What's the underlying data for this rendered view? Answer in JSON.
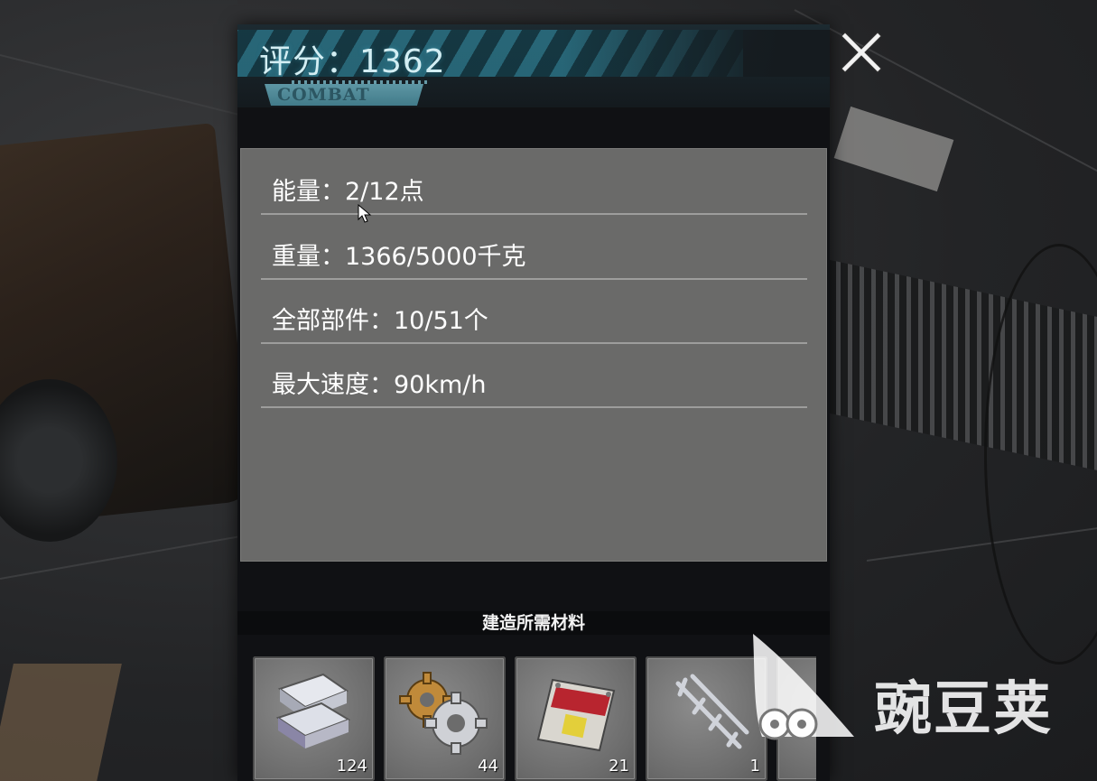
{
  "panel": {
    "score_text": "评分：1362",
    "combat_tag": "COMBAT",
    "stats": [
      {
        "text": "能量：2/12点"
      },
      {
        "text": "重量：1366/5000千克"
      },
      {
        "text": "全部部件：10/51个"
      },
      {
        "text": "最大速度：90km/h"
      }
    ],
    "materials_title": "建造所需材料",
    "materials": [
      {
        "icon": "metal-ingot-icon",
        "count": "124"
      },
      {
        "icon": "gears-icon",
        "count": "44"
      },
      {
        "icon": "license-plate-icon",
        "count": "21"
      },
      {
        "icon": "metal-frame-icon",
        "count": "1"
      }
    ]
  },
  "close_icon": "close-icon",
  "watermark": {
    "text": "豌豆荚",
    "icon": "wandoujia-logo-icon"
  },
  "colors": {
    "score_text": "#d3eef3",
    "score_stripe": "#2a7184",
    "stats_bg": "#6a6a69",
    "panel_bg": "#101114"
  }
}
